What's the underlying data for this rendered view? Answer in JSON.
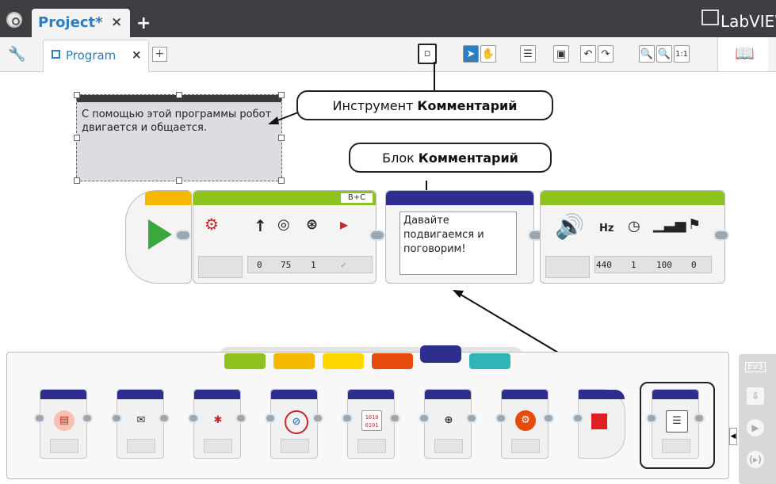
{
  "top_bar": {
    "project_tab_label": "Project*",
    "close_symbol": "×",
    "add_symbol": "+",
    "brand": "LabVIEW"
  },
  "program_bar": {
    "program_tab_label": "Program",
    "close_symbol": "×",
    "add_symbol": "+",
    "zoom_reset_label": "1:1"
  },
  "canvas": {
    "comment_text": "С помощью этой программы робот двигается и общается.",
    "callout_tool": {
      "prefix": "Инструмент",
      "bold": "Комментарий"
    },
    "callout_block": {
      "prefix": "Блок",
      "bold": "Комментарий"
    },
    "move_block": {
      "ports": "B+C",
      "values": [
        "0",
        "75",
        "1"
      ]
    },
    "comment_block_text": "Давайте подвигаемся и поговорим!",
    "sound_block": {
      "hz_label": "Hz",
      "values": [
        "440",
        "1",
        "100",
        "0"
      ]
    }
  },
  "palette": {
    "tab_colors": [
      "#8dc21f",
      "#f5b800",
      "#ffd800",
      "#e84a0c",
      "#2e2e8e",
      "#2fb5b5"
    ],
    "blocks": [
      "file-access-icon",
      "messaging-icon",
      "bluetooth-icon",
      "stop-icon",
      "raw-data-icon",
      "motor-invert-icon",
      "unregulated-motor-icon",
      "stop-block-icon",
      "comment-icon"
    ],
    "raw_data_label": "1010\n0101"
  },
  "ev3": {
    "label": "EV3"
  }
}
